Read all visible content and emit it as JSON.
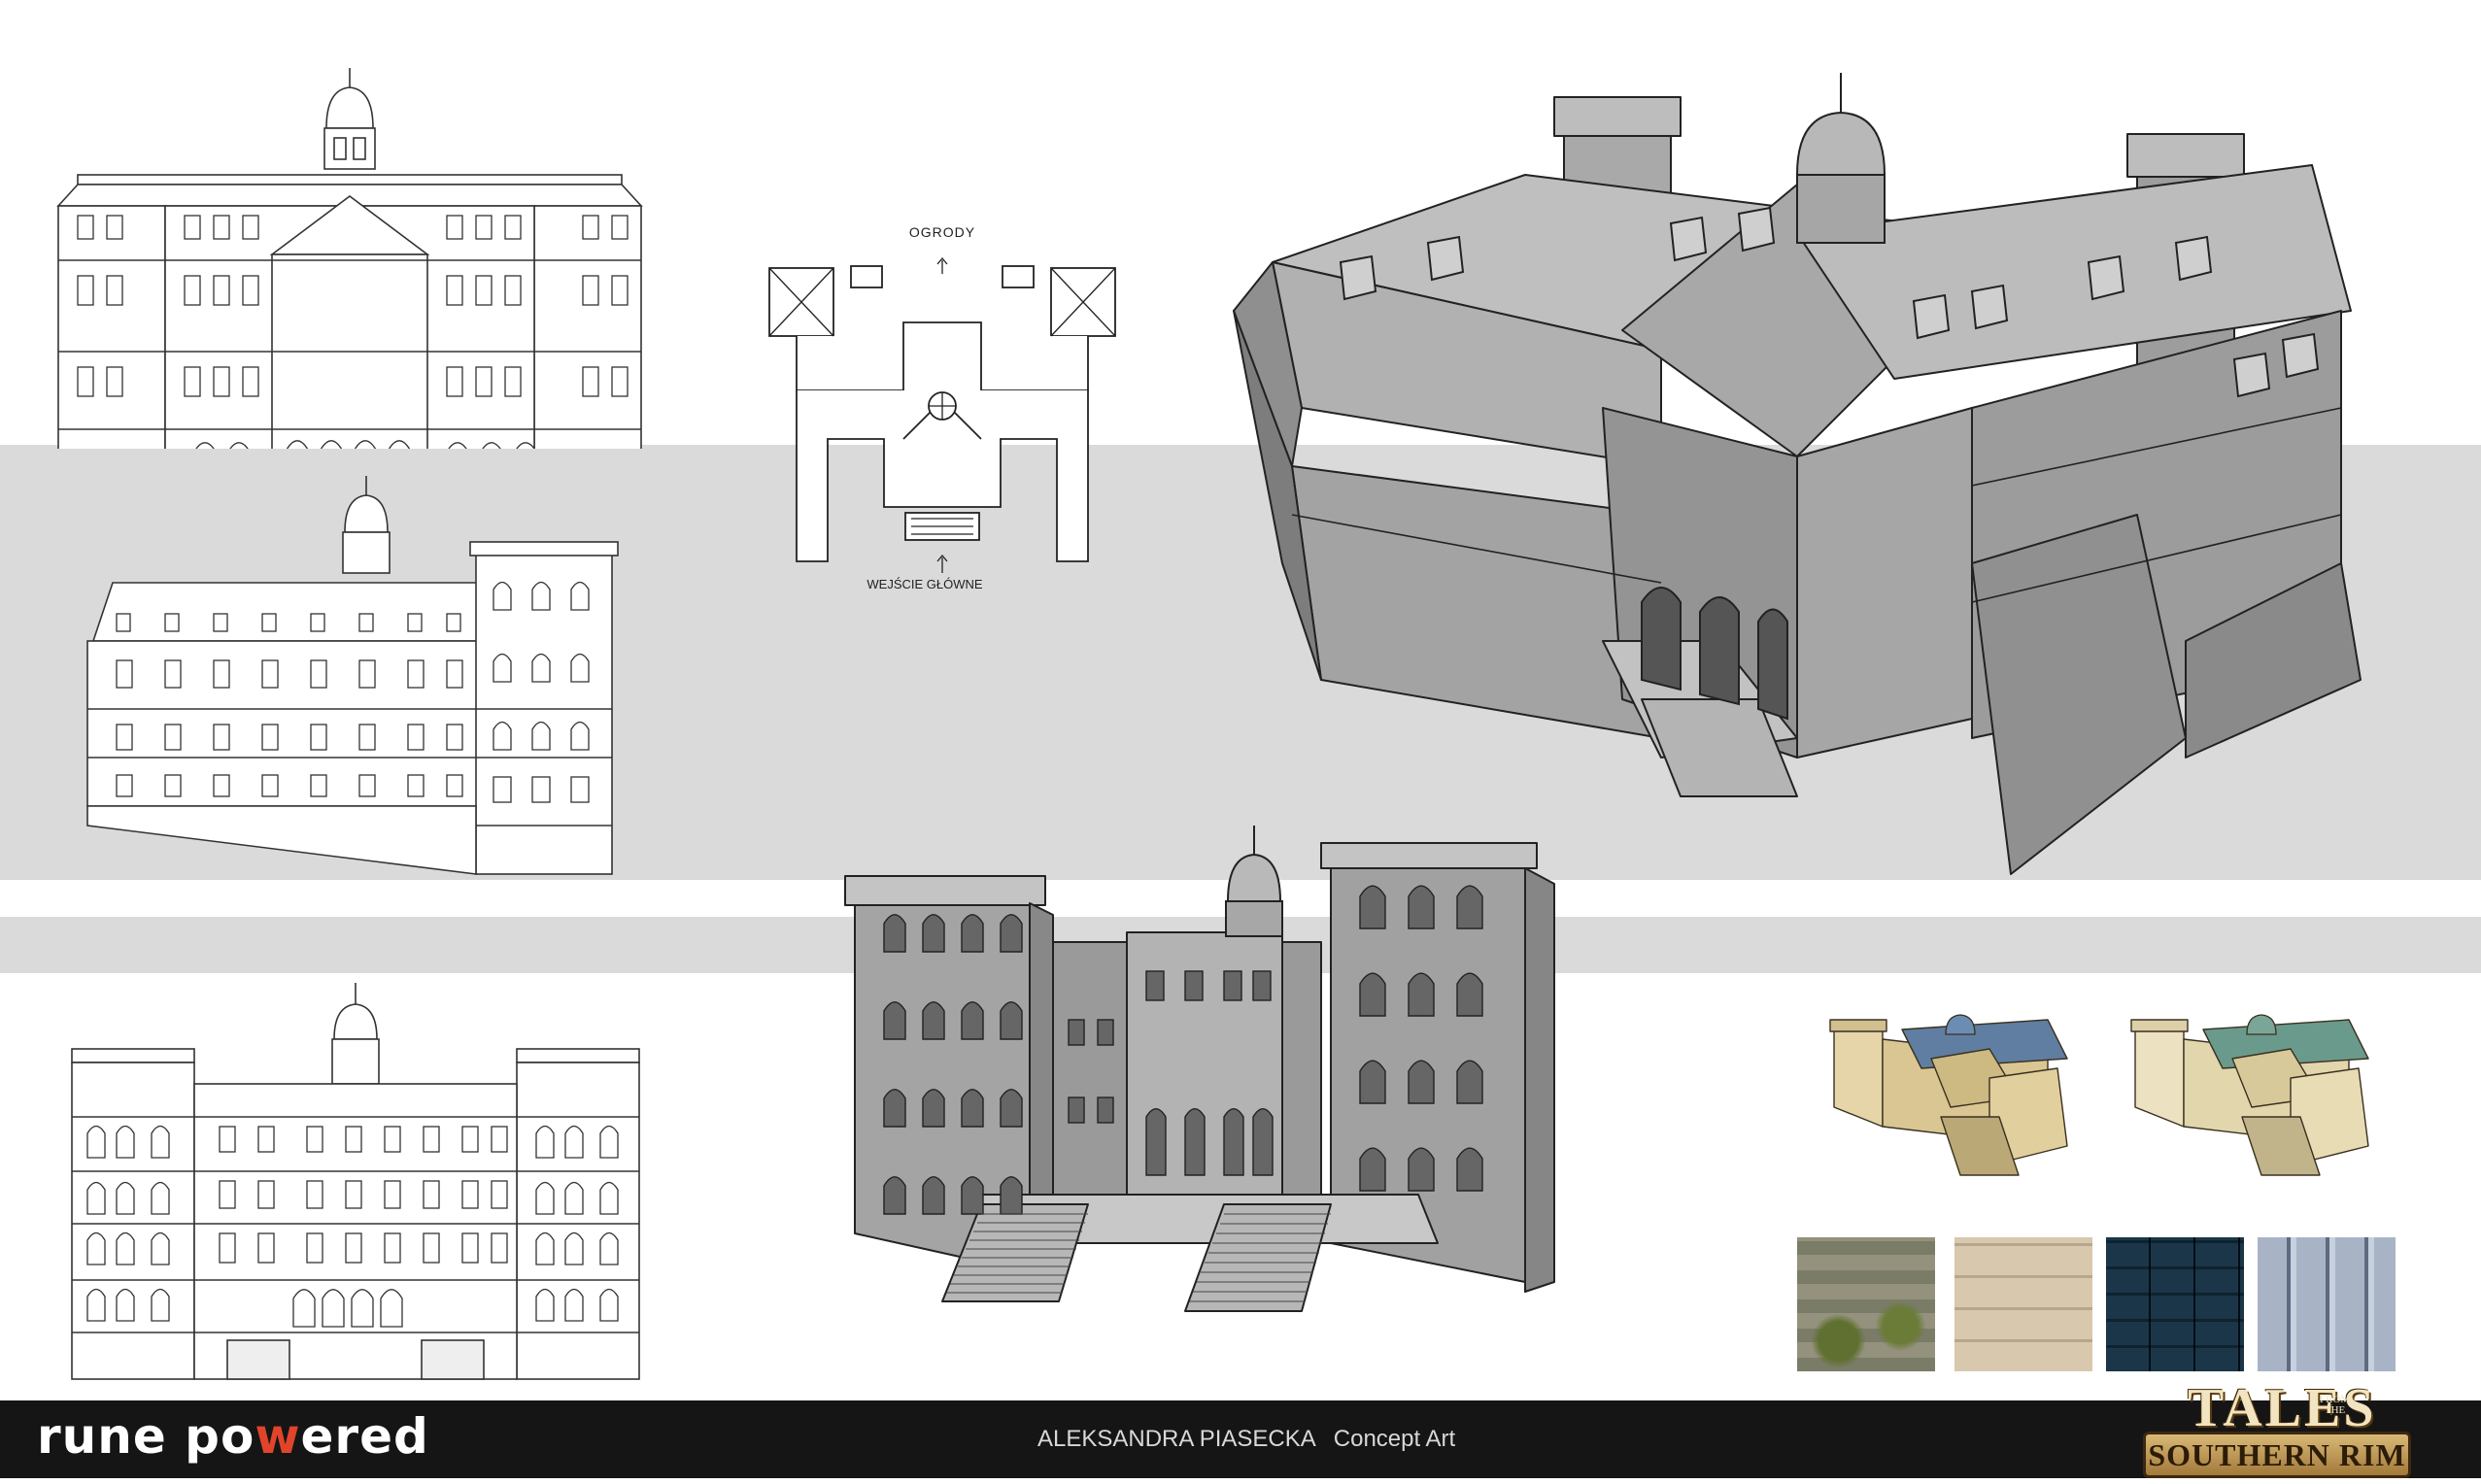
{
  "plan": {
    "label_top": "OGRODY",
    "label_bottom": "WEJŚCIE GŁÓWNE"
  },
  "footer": {
    "brand_part1": "rune po",
    "brand_accent": "w",
    "brand_part2": "ered",
    "artist": "ALEKSANDRA PIASECKA",
    "role": "Concept Art"
  },
  "game_logo": {
    "title_top": "TALES",
    "title_from_1": "FROM",
    "title_from_2": "THE",
    "title_bottom": "SOUTHERN RIM"
  },
  "colors": {
    "band_gray": "#dadada",
    "footer_bg": "#151515",
    "brand_accent": "#e0442a",
    "model_gray": "#9a9a9a",
    "logo_gold": "#c9a45c"
  },
  "textures": [
    {
      "name": "mossy-stone-texture"
    },
    {
      "name": "sandstone-texture"
    },
    {
      "name": "blue-slate-roof-texture"
    },
    {
      "name": "metal-panel-texture"
    }
  ]
}
